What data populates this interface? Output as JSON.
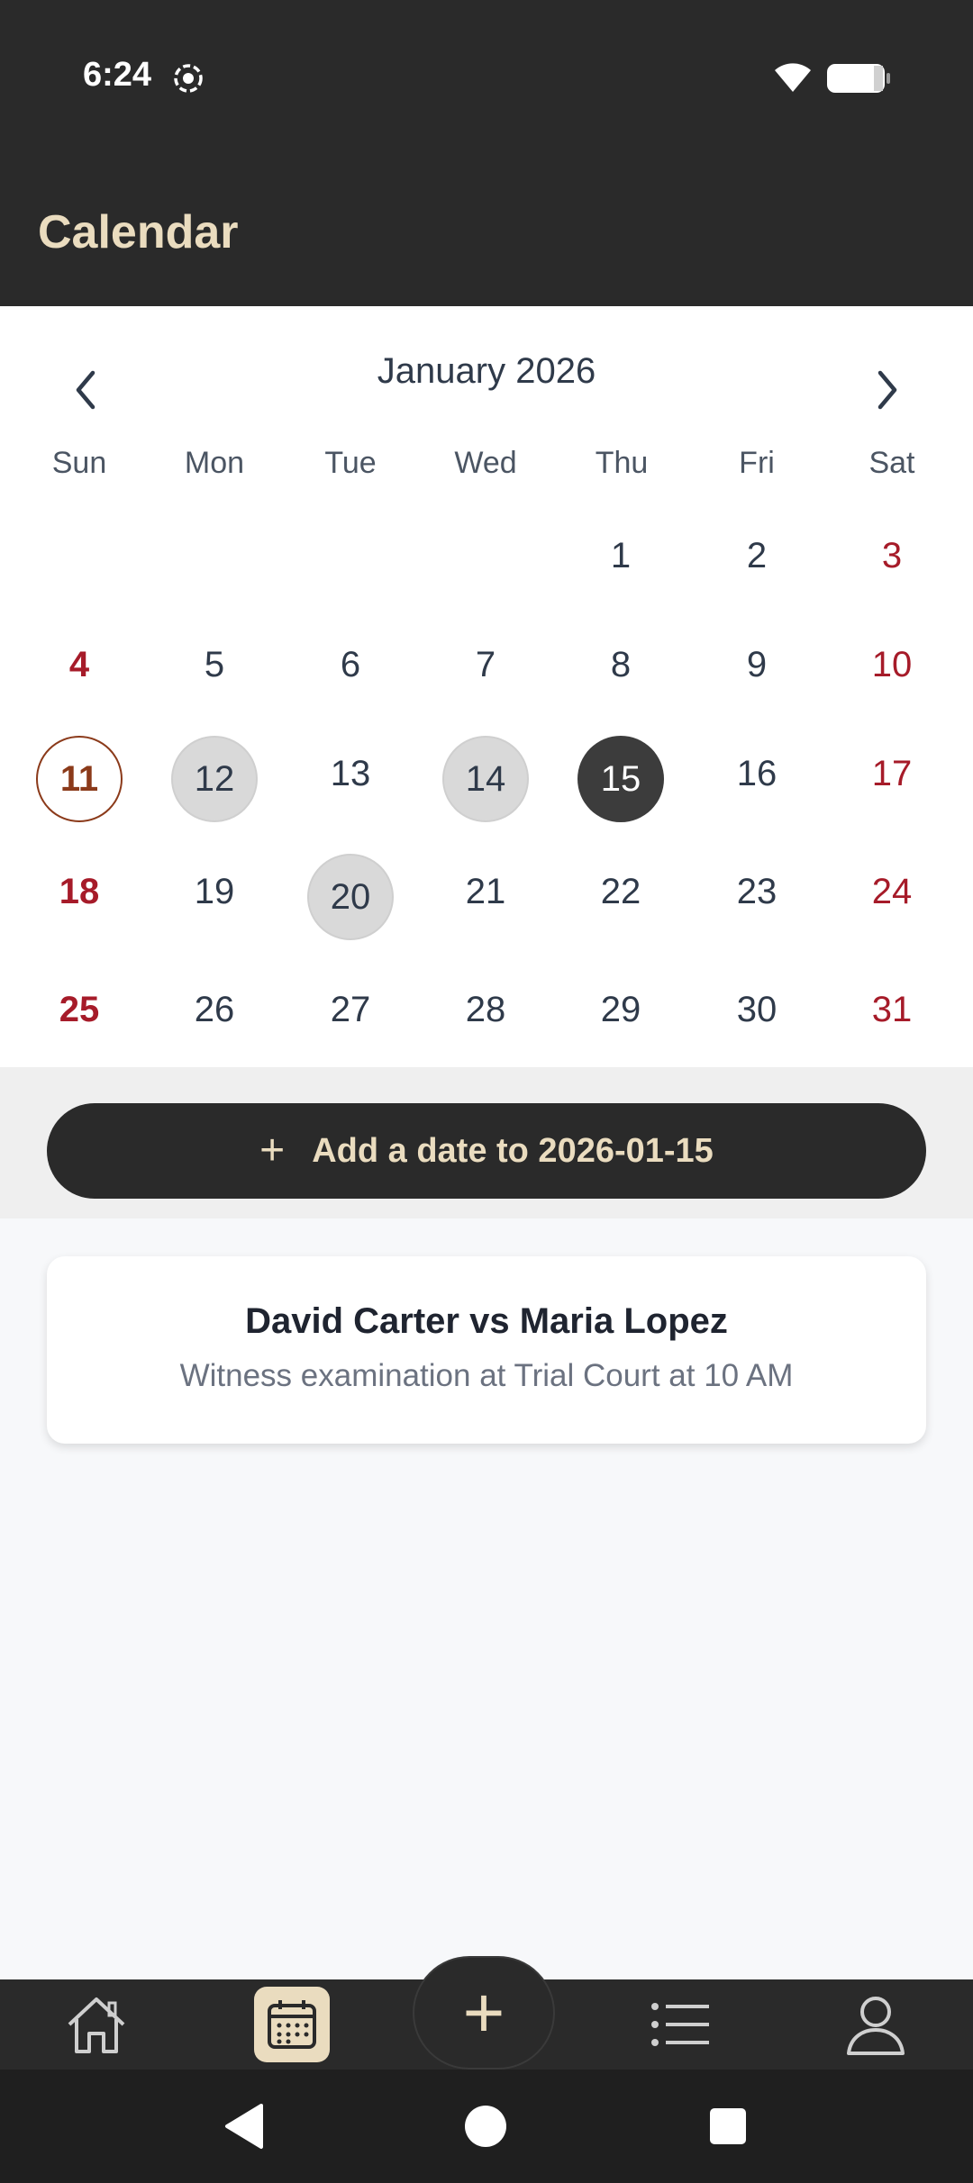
{
  "status_bar": {
    "time": "6:24"
  },
  "app_bar": {
    "title": "Calendar"
  },
  "calendar": {
    "month_label": "January 2026",
    "weekdays": [
      "Sun",
      "Mon",
      "Tue",
      "Wed",
      "Thu",
      "Fri",
      "Sat"
    ],
    "days": [
      "1",
      "2",
      "3",
      "4",
      "5",
      "6",
      "7",
      "8",
      "9",
      "10",
      "11",
      "12",
      "13",
      "14",
      "15",
      "16",
      "17",
      "18",
      "19",
      "20",
      "21",
      "22",
      "23",
      "24",
      "25",
      "26",
      "27",
      "28",
      "29",
      "30",
      "31"
    ],
    "today": "11",
    "selected": "15",
    "event_days": [
      "12",
      "14",
      "20"
    ]
  },
  "add_button": {
    "label": "Add a date to 2026-01-15",
    "icon": "plus-icon"
  },
  "event": {
    "title": "David Carter vs Maria Lopez",
    "description": "Witness examination at Trial Court at 10 AM"
  },
  "bottom_nav": {
    "items": [
      "home-icon",
      "calendar-icon",
      "add-icon",
      "list-icon",
      "profile-icon"
    ],
    "active": "calendar-icon"
  },
  "colors": {
    "bar": "#2a2a2a",
    "accent": "#eadcbf",
    "weekend": "#a61b29",
    "today_ring": "#8b3a1a",
    "selected": "#3c3c3c"
  }
}
